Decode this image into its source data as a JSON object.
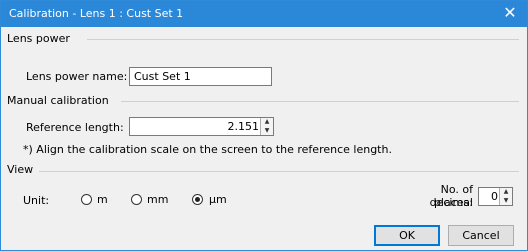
{
  "window": {
    "title": "Calibration - Lens 1 : Cust Set 1",
    "close_glyph": "✕"
  },
  "lens_power": {
    "group_label": "Lens power",
    "name_label": "Lens power name:",
    "name_value": "Cust Set 1"
  },
  "manual_calibration": {
    "group_label": "Manual calibration",
    "reference_length_label": "Reference length:",
    "reference_length_value": "2.151",
    "note": "*) Align the calibration scale on the screen to the reference length."
  },
  "view": {
    "group_label": "View",
    "unit_label": "Unit:",
    "unit_options": [
      {
        "label": "m",
        "selected": false
      },
      {
        "label": "mm",
        "selected": false
      },
      {
        "label": "µm",
        "selected": true
      }
    ],
    "decimal_label_line1": "No. of decimal",
    "decimal_label_line2": "places:",
    "decimal_value": "0"
  },
  "buttons": {
    "ok": "OK",
    "cancel": "Cancel"
  },
  "colors": {
    "titlebar": "#2b88d8",
    "dialog_bg": "#f0f0f0",
    "default_button_border": "#0078d7"
  }
}
